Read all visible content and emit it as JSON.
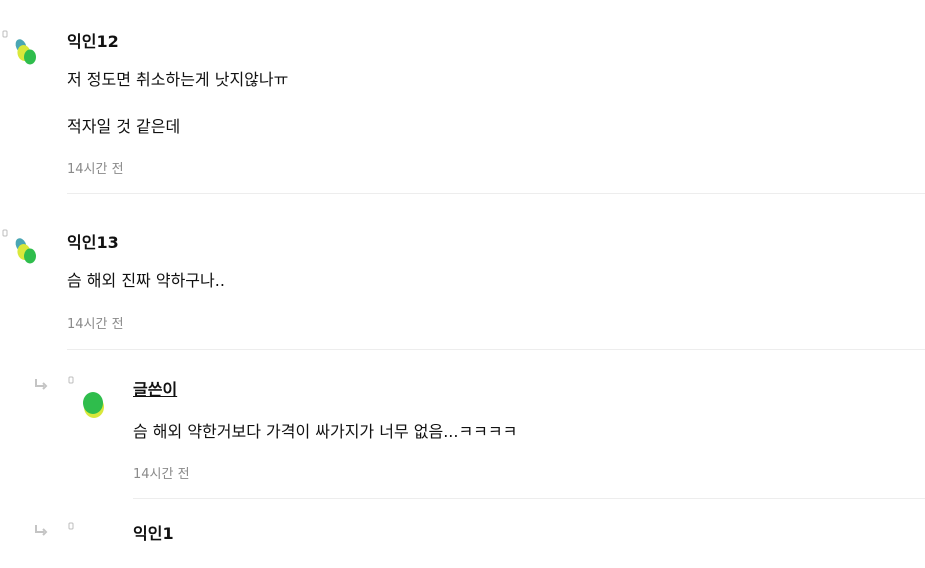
{
  "comments": [
    {
      "name": "익인12",
      "lines": [
        "저 정도면 취소하는게 낫지않나ㅠ",
        "적자일 것 같은데"
      ],
      "time": "14시간 전"
    },
    {
      "name": "익인13",
      "lines": [
        "슴 해외 진짜 약하구나.."
      ],
      "time": "14시간 전"
    }
  ],
  "replies": [
    {
      "name": "글쓴이",
      "lines": [
        "슴 해외 약한거보다 가격이 싸가지가 너무 없음...ㅋㅋㅋㅋ"
      ],
      "time": "14시간 전"
    },
    {
      "name": "익인1"
    }
  ],
  "colors": {
    "avatar_teal": "#4aa6b4",
    "avatar_green": "#2fbd4c",
    "avatar_yellow": "#d9e83a",
    "meta_gray": "#8a8a8a"
  }
}
